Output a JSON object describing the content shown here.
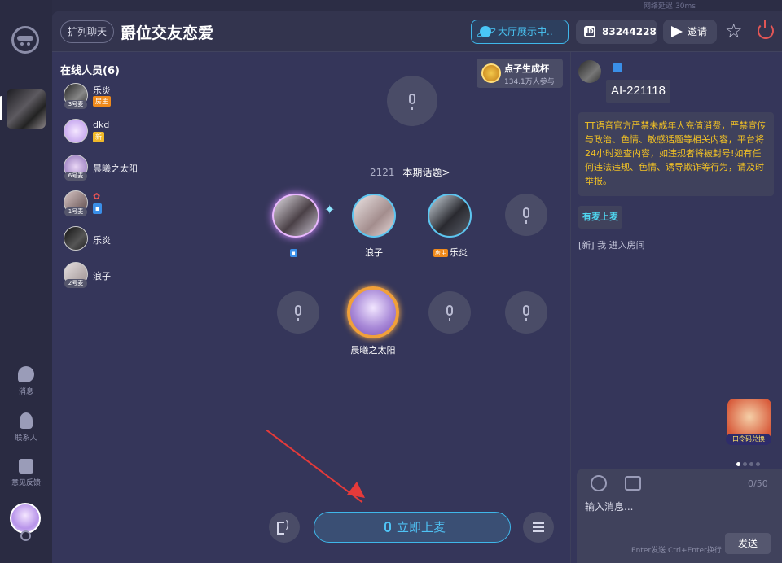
{
  "top_bar": {
    "latency": "网络延迟:30ms"
  },
  "sidebar": {
    "items": [
      {
        "label": "消息",
        "icon": "message-icon"
      },
      {
        "label": "联系人",
        "icon": "contact-icon"
      },
      {
        "label": "意见反馈",
        "icon": "feedback-icon"
      }
    ]
  },
  "header": {
    "expand_label": "扩列聊天",
    "room_title": "爵位交友恋爱",
    "hall_label": "大厅展示中..",
    "room_id": "83244228",
    "invite_label": "邀请"
  },
  "online": {
    "title": "在线人员(6)",
    "members": [
      {
        "name": "乐炎",
        "mic_no": "3号麦",
        "badge": "房主"
      },
      {
        "name": "dkd",
        "mic_no": "",
        "badge": "新"
      },
      {
        "name": "晨曦之太阳",
        "mic_no": "6号麦",
        "badge": ""
      },
      {
        "name": "",
        "mic_no": "1号麦",
        "badge": ""
      },
      {
        "name": "乐炎",
        "mic_no": "",
        "badge": ""
      },
      {
        "name": "浪子",
        "mic_no": "2号麦",
        "badge": ""
      }
    ]
  },
  "cup": {
    "title": "点子生成杯",
    "subtitle": "134.1万人参与"
  },
  "stage": {
    "topic_count": "2121",
    "topic_link": "本期话题>",
    "seats": [
      {
        "name": "",
        "badge": ""
      },
      {
        "name": "浪子",
        "badge": ""
      },
      {
        "name": "乐炎",
        "badge": "房主"
      },
      {
        "name": "晨曦之太阳",
        "badge": ""
      }
    ]
  },
  "controls": {
    "join_label": "立即上麦"
  },
  "chat": {
    "message_text": "AI-221118",
    "notice": "TT语音官方严禁未成年人充值消费，严禁宣传与政治、色情、敏感话题等相关内容，平台将24小时巡查内容，如违规者将被封号!如有任何违法违规、色情、诱导欺诈等行为，请及时举报。",
    "onmic_label": "有麦上麦",
    "join_msg": "[新] 我 进入房间",
    "promo_label": "口令码兑换",
    "counter": "0/50",
    "input_placeholder": "输入消息...",
    "send_hint": "Enter发送 Ctrl+Enter换行",
    "send_label": "发送"
  },
  "colors": {
    "accent": "#3fb7ea",
    "notice": "#f3c224",
    "power": "#e25656",
    "arrow": "#e53a3a"
  }
}
